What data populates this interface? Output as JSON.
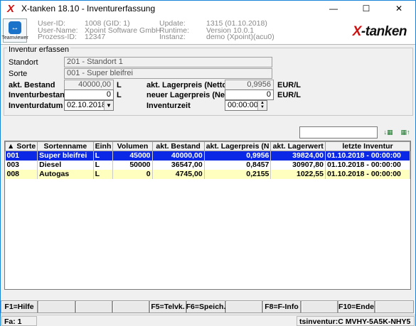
{
  "window": {
    "title": "X-tanken 18.10 - Inventurerfassung",
    "app_icon": "X"
  },
  "info": {
    "teamviewer_label": "Teamviewer",
    "user_id_label": "User-ID:",
    "user_id": "1008 (GID: 1)",
    "user_name_label": "User-Name:",
    "user_name": "Xpoint Software GmbH",
    "process_id_label": "Prozess-ID:",
    "process_id": "12347",
    "update_label": "Update:",
    "update": "1315 (01.10.2018)",
    "runtime_label": "Runtime:",
    "runtime": "Version 10.0.1",
    "instance_label": "Instanz:",
    "instance": "demo (Xpoint)(acu0)",
    "logo_x": "X",
    "logo_rest": "-tanken"
  },
  "form": {
    "legend": "Inventur erfassen",
    "standort_label": "Standort",
    "standort": "201 - Standort 1",
    "sorte_label": "Sorte",
    "sorte": "001 - Super bleifrei",
    "akt_bestand_label": "akt. Bestand",
    "akt_bestand": "40000,00",
    "akt_bestand_unit": "L",
    "inventurbestand_label": "Inventurbestand",
    "inventurbestand": "0",
    "inventurbestand_unit": "L",
    "inventurdatum_label": "Inventurdatum",
    "inventurdatum": "02.10.2018",
    "akt_lagerpreis_label": "akt. Lagerpreis (Netto)",
    "akt_lagerpreis": "0,9956",
    "akt_lagerpreis_unit": "EUR/L",
    "neuer_lagerpreis_label": "neuer Lagerpreis (Netto)",
    "neuer_lagerpreis": "0",
    "neuer_lagerpreis_unit": "EUR/L",
    "inventurzeit_label": "Inventurzeit",
    "inventurzeit": "00:00:00"
  },
  "search": {
    "value": ""
  },
  "table": {
    "headers": [
      "Sorte",
      "Sortenname",
      "Einh",
      "Volumen",
      "akt. Bestand",
      "akt. Lagerpreis (N",
      "akt. Lagerwert",
      "letzte Inventur"
    ],
    "rows": [
      {
        "sorte": "001",
        "name": "Super bleifrei",
        "einh": "L",
        "volumen": "45000",
        "bestand": "40000,00",
        "lagerpreis": "0,9956",
        "lagerwert": "39824,00",
        "inventur": "01.10.2018 - 00:00:00"
      },
      {
        "sorte": "003",
        "name": "Diesel",
        "einh": "L",
        "volumen": "50000",
        "bestand": "36547,00",
        "lagerpreis": "0,8457",
        "lagerwert": "30907,80",
        "inventur": "01.10.2018 - 00:00:00"
      },
      {
        "sorte": "008",
        "name": "Autogas",
        "einh": "L",
        "volumen": "0",
        "bestand": "4745,00",
        "lagerpreis": "0,2155",
        "lagerwert": "1022,55",
        "inventur": "01.10.2018 - 00:00:00"
      }
    ]
  },
  "fkeys": [
    "F1=Hilfe",
    "",
    "",
    "",
    "F5=Telvk.",
    "F6=Speich.",
    "",
    "F8=F-Info",
    "",
    "F10=Ende",
    ""
  ],
  "status": {
    "left": "Fa: 1",
    "right": "tsinventur:C MVHY-5A5K-NHY5"
  }
}
